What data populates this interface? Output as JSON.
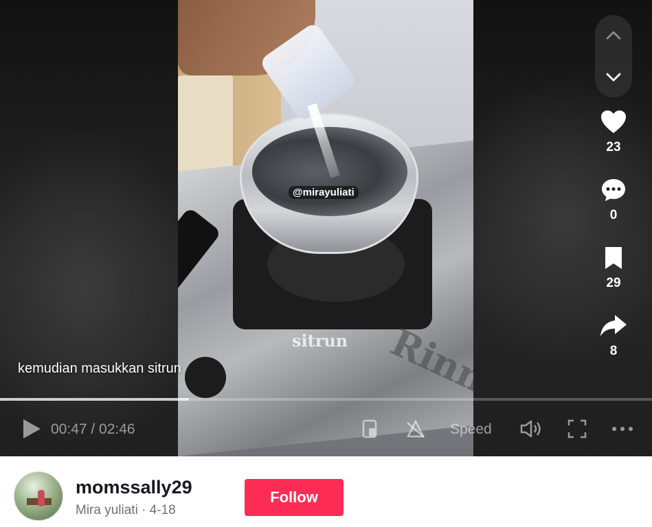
{
  "video": {
    "watermark": "@mirayuliati",
    "overlay_text": "sitrun",
    "stove_brand": "Rinn",
    "caption": "kemudian masukkan sitrun",
    "progress_fraction": 0.29
  },
  "controls": {
    "time": "00:47 / 02:46",
    "speed_label": "Speed"
  },
  "actions": {
    "likes": "23",
    "comments": "0",
    "saves": "29",
    "shares": "8"
  },
  "author": {
    "username": "momssally29",
    "display_line": "Mira yuliati · 4-18",
    "follow_label": "Follow"
  },
  "colors": {
    "follow": "#fe2c55",
    "text_dark": "#161823",
    "text_muted": "#6f7078"
  },
  "icons": [
    "chevron-up-icon",
    "chevron-down-icon",
    "heart-icon",
    "comment-icon",
    "bookmark-icon",
    "share-icon",
    "play-icon",
    "pip-icon",
    "flip-icon",
    "volume-icon",
    "fullscreen-icon",
    "more-icon"
  ]
}
